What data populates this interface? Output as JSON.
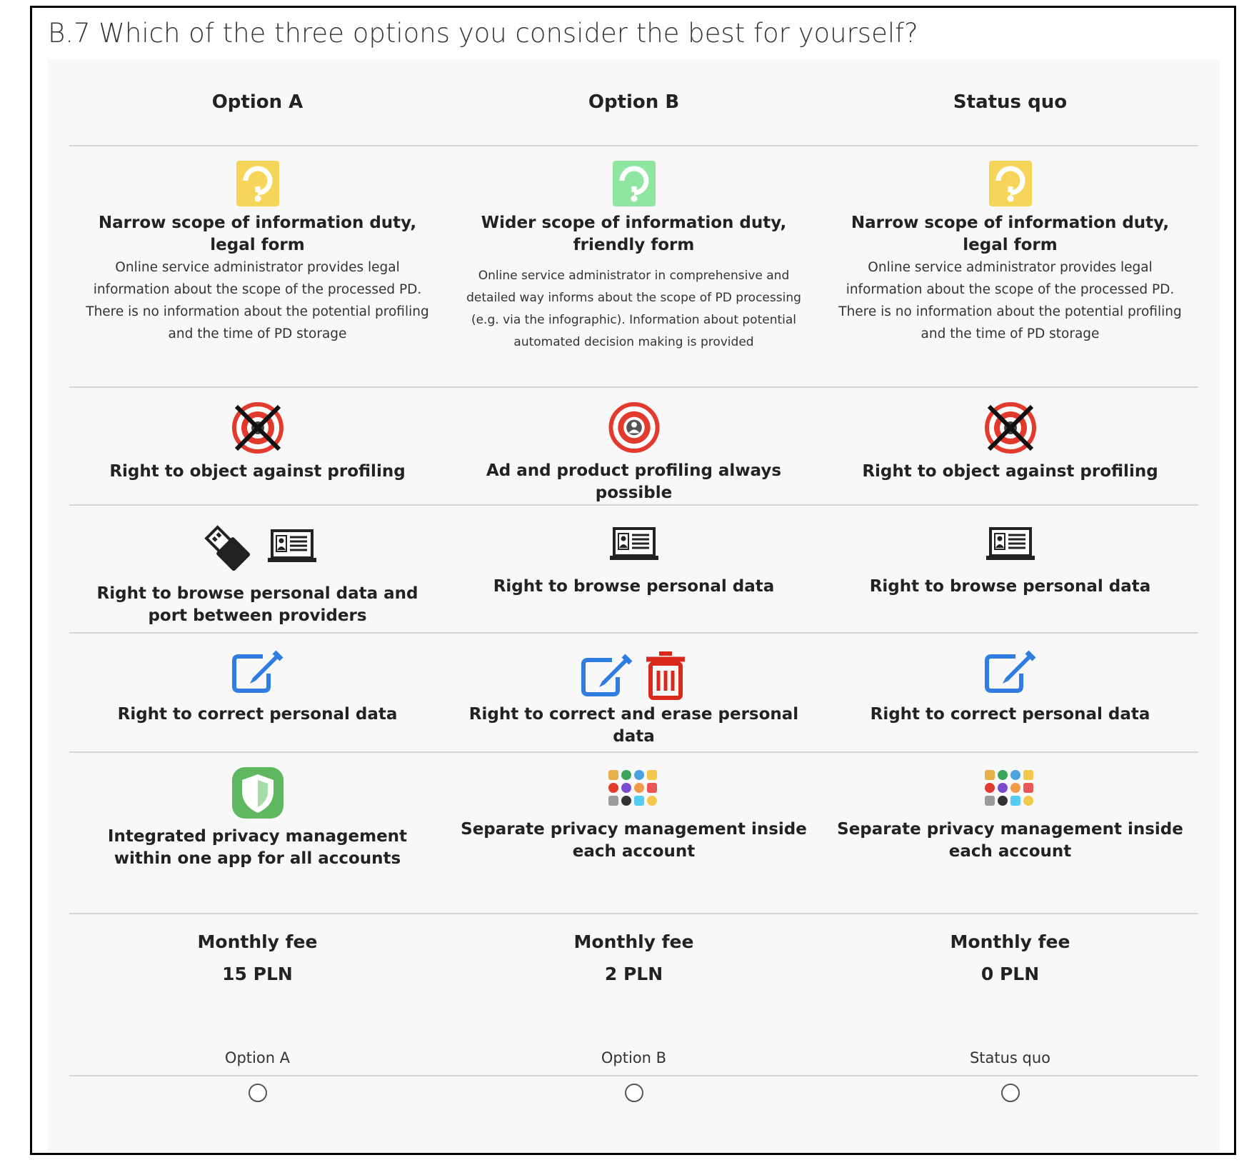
{
  "question": "B.7 Which of the three options you consider the best for yourself?",
  "columns": [
    {
      "header": "Option A",
      "info_title": "Narrow scope of information duty, legal form",
      "info_desc": "Online service administrator provides legal information about the scope of the processed PD. There is no information about the potential profiling and the time of PD storage",
      "info_icon": "question-mark-icon",
      "info_icon_color": "#f6d659",
      "profiling": "Right to object against profiling",
      "profiling_icon": "crossed-target-icon",
      "browse": "Right to browse personal data and port between providers",
      "correct": "Right to correct personal data",
      "privacy": "Integrated privacy management within one app for all accounts",
      "privacy_icon": "shield-icon",
      "fee_label": "Monthly fee",
      "fee_value": "15 PLN",
      "choice_label": "Option A"
    },
    {
      "header": "Option B",
      "info_title": "Wider scope of information duty, friendly form",
      "info_desc": "Online service administrator in comprehensive and detailed way informs about the scope of PD processing (e.g. via the infographic). Information about potential automated decision making is provided",
      "info_icon": "question-mark-icon",
      "info_icon_color": "#8ee6a1",
      "profiling": "Ad and product profiling always possible",
      "profiling_icon": "target-person-icon",
      "browse": "Right to browse personal data",
      "correct": "Right to correct and erase personal data",
      "privacy": "Separate privacy management inside each account",
      "privacy_icon": "app-grid-icon",
      "fee_label": "Monthly fee",
      "fee_value": "2 PLN",
      "choice_label": "Option B"
    },
    {
      "header": "Status quo",
      "info_title": "Narrow scope of information duty, legal form",
      "info_desc": "Online service administrator provides legal information about the scope of the processed PD. There is no information about the potential profiling and the time of PD storage",
      "info_icon": "question-mark-icon",
      "info_icon_color": "#f6d659",
      "profiling": "Right to object against profiling",
      "profiling_icon": "crossed-target-icon",
      "browse": "Right to browse personal data",
      "correct": "Right to correct personal data",
      "privacy": "Separate privacy management inside each account",
      "privacy_icon": "app-grid-icon",
      "fee_label": "Monthly fee",
      "fee_value": "0 PLN",
      "choice_label": "Status quo"
    }
  ],
  "colors": {
    "target_red": "#e23b2e",
    "edit_blue": "#2f7de1",
    "trash_red": "#d8291c",
    "shield_green": "#5fb760"
  }
}
